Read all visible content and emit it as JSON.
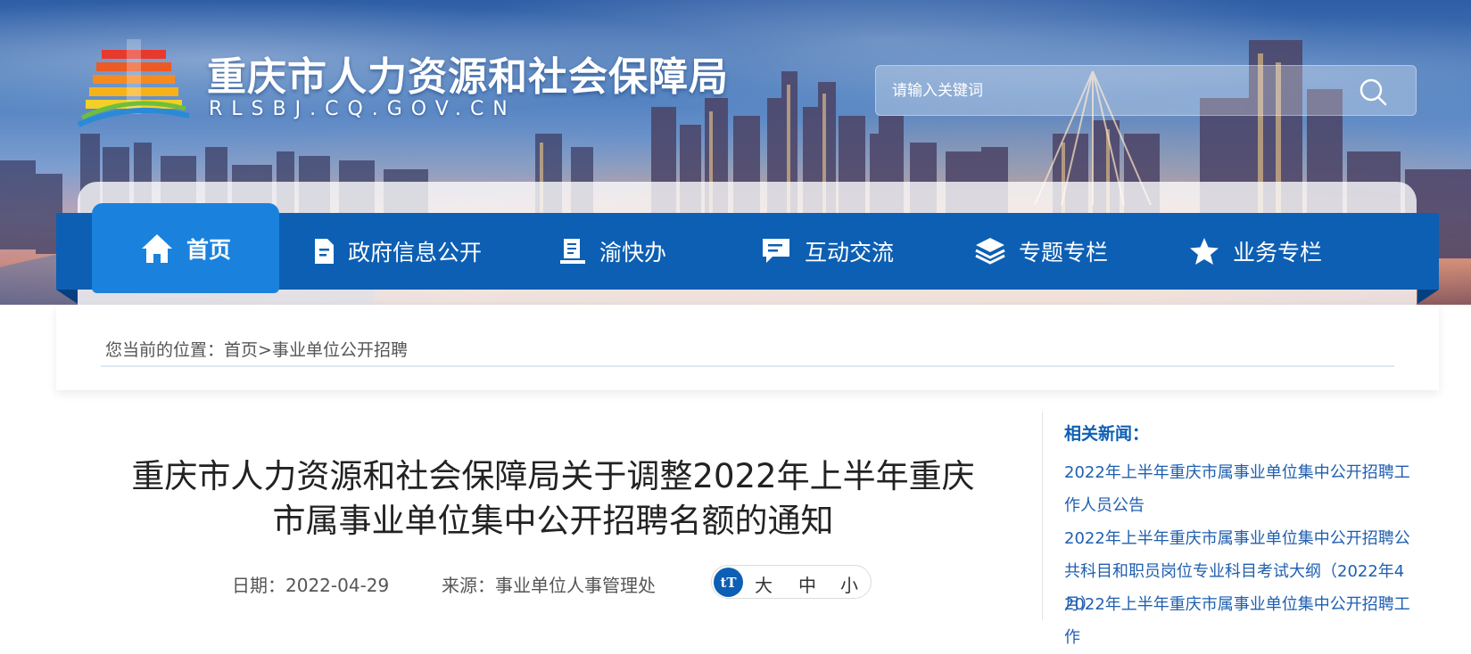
{
  "header": {
    "site_title": "重庆市人力资源和社会保障局",
    "site_domain": "RLSBJ.CQ.GOV.CN",
    "search_placeholder": "请输入关键词"
  },
  "nav": {
    "items": [
      {
        "label": "首页",
        "icon": "home-icon",
        "active": true
      },
      {
        "label": "政府信息公开",
        "icon": "document-icon"
      },
      {
        "label": "渝快办",
        "icon": "book-icon"
      },
      {
        "label": "互动交流",
        "icon": "chat-icon"
      },
      {
        "label": "专题专栏",
        "icon": "layers-icon"
      },
      {
        "label": "业务专栏",
        "icon": "star-icon"
      }
    ]
  },
  "breadcrumb": {
    "prefix": "您当前的位置：",
    "home": "首页",
    "separator": ">",
    "current": "事业单位公开招聘"
  },
  "article": {
    "title_line1": "重庆市人力资源和社会保障局关于调整2022年上半年重庆",
    "title_line2": "市属事业单位集中公开招聘名额的通知",
    "date": "日期：2022-04-29",
    "source": "来源：事业单位人事管理处",
    "font_size_icon": "tT",
    "font_large": "大",
    "font_medium": "中",
    "font_small": "小"
  },
  "related": {
    "title": "相关新闻：",
    "items": [
      "2022年上半年重庆市属事业单位集中公开招聘工作人员公告",
      "2022年上半年重庆市属事业单位集中公开招聘公共科目和职员岗位专业科目考试大纲（2022年4月）",
      "2022年上半年重庆市属事业单位集中公开招聘工作"
    ]
  },
  "colors": {
    "nav_blue": "#0d5fb3",
    "nav_active": "#1a82dd",
    "link_blue": "#1f5fb0"
  }
}
